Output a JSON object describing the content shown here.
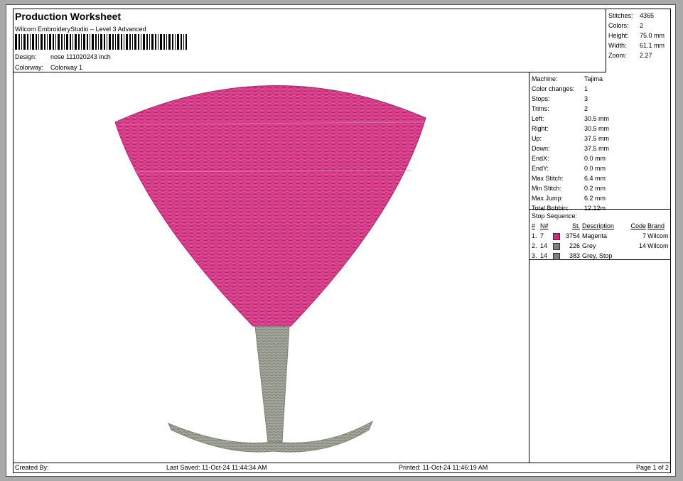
{
  "title": "Production Worksheet",
  "subtitle": "Wilcom EmbroideryStudio – Level 3 Advanced",
  "design": {
    "label": "Design:",
    "value": "nose 111020243 inch"
  },
  "colorway": {
    "label": "Colorway:",
    "value": "Colorway 1"
  },
  "stats": [
    {
      "label": "Stitches:",
      "value": "4365"
    },
    {
      "label": "Colors:",
      "value": "2"
    },
    {
      "label": "Height:",
      "value": "75.0 mm"
    },
    {
      "label": "Width:",
      "value": "61.1 mm"
    },
    {
      "label": "Zoom:",
      "value": "2.27"
    }
  ],
  "machine_info": [
    {
      "label": "Machine:",
      "value": "Tajima"
    },
    {
      "label": "Color changes:",
      "value": "1"
    },
    {
      "label": "Stops:",
      "value": "3"
    },
    {
      "label": "Trims:",
      "value": "2"
    },
    {
      "label": "Left:",
      "value": "30.5 mm"
    },
    {
      "label": "Right:",
      "value": "30.5 mm"
    },
    {
      "label": "Up:",
      "value": "37.5 mm"
    },
    {
      "label": "Down:",
      "value": "37.5 mm"
    },
    {
      "label": "EndX:",
      "value": "0.0 mm"
    },
    {
      "label": "EndY:",
      "value": "0.0 mm"
    },
    {
      "label": "Max Stitch:",
      "value": "6.4 mm"
    },
    {
      "label": "Min Stitch:",
      "value": "0.2 mm"
    },
    {
      "label": "Max Jump:",
      "value": "6.2 mm"
    },
    {
      "label": "Total Bobbin:",
      "value": "12.12m"
    }
  ],
  "stop_sequence": {
    "heading": "Stop Sequence:",
    "columns": [
      "#",
      "N#",
      "St.",
      "Description",
      "Code",
      "Brand"
    ],
    "rows": [
      {
        "index": "1.",
        "needle": "7",
        "stitches": "3754",
        "description": "Magenta",
        "code": "7",
        "brand": "Wilcom",
        "color": "#d02a7a"
      },
      {
        "index": "2.",
        "needle": "14",
        "stitches": "226",
        "description": "Grey",
        "code": "14",
        "brand": "Wilcom",
        "color": "#808080"
      },
      {
        "index": "3.",
        "needle": "14",
        "stitches": "383",
        "description": "Grey, Stop",
        "code": "",
        "brand": "",
        "color": "#808080"
      }
    ]
  },
  "footer": {
    "created_by": "Created By:",
    "last_saved": "Last Saved: 11-Oct-24 11:44:34 AM",
    "printed": "Printed: 11-Oct-24 11:46:19 AM",
    "page": "Page 1 of 2"
  },
  "colors": {
    "magenta": "#d83a8a",
    "grey": "#a4a79c"
  }
}
